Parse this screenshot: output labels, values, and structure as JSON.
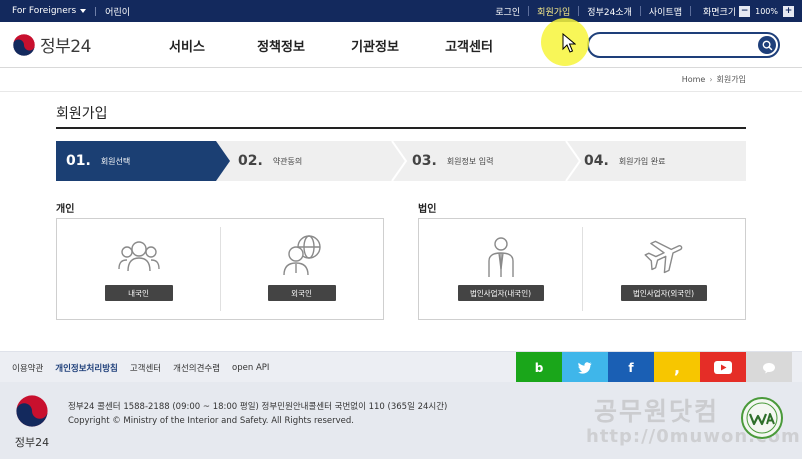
{
  "topbar": {
    "foreigners": "For Foreigners",
    "kids": "어린이",
    "login": "로그인",
    "signup": "회원가입",
    "about": "정부24소개",
    "sitemap": "사이트맵",
    "zoom_label": "화면크기",
    "zoom_minus": "−",
    "zoom_value": "100%",
    "zoom_plus": "+"
  },
  "header": {
    "logo_text": "정부24",
    "menu": [
      "서비스",
      "정책정보",
      "기관정보",
      "고객센터"
    ],
    "search_placeholder": ""
  },
  "breadcrumb": {
    "home": "Home",
    "current": "회원가입"
  },
  "page": {
    "title": "회원가입",
    "steps": [
      {
        "num": "01.",
        "label": "회원선택"
      },
      {
        "num": "02.",
        "label": "약관동의"
      },
      {
        "num": "03.",
        "label": "회원정보 입력"
      },
      {
        "num": "04.",
        "label": "회원가입 완료"
      }
    ],
    "current_step": 1,
    "personal": {
      "title": "개인",
      "domestic": "내국인",
      "foreigner": "외국인"
    },
    "corporate": {
      "title": "법인",
      "domestic": "법인사업자(내국인)",
      "foreign": "법인사업자(외국인)"
    }
  },
  "footer": {
    "links": [
      "이용약관",
      "개인정보처리방침",
      "고객센터",
      "개선의견수렴",
      "open API"
    ],
    "sns": [
      {
        "name": "blog",
        "glyph": "b",
        "color": "#1aa61a"
      },
      {
        "name": "twitter",
        "glyph": "",
        "color": "#3fb6ea"
      },
      {
        "name": "facebook",
        "glyph": "f",
        "color": "#1a5fb4"
      },
      {
        "name": "kakao",
        "glyph": ",",
        "color": "#f7c600"
      },
      {
        "name": "youtube",
        "glyph": "",
        "color": "#e52d27"
      },
      {
        "name": "talk",
        "glyph": "",
        "color": "#d9d9d9"
      }
    ],
    "logo_text": "정부24",
    "line1": "정부24 콜센터 1588-2188 (09:00 ~ 18:00 평일) 정부민원안내콜센터 국번없이 110 (365일 24시간)",
    "line2": "Copyright © Ministry of the Interior and Safety. All Rights reserved.",
    "watermark1": "공무원닷컴",
    "watermark2": "http://0muwon.com"
  },
  "colors": {
    "navy": "#13295d",
    "step_active": "#1b3f73",
    "signup_active": "#f5e98a"
  }
}
